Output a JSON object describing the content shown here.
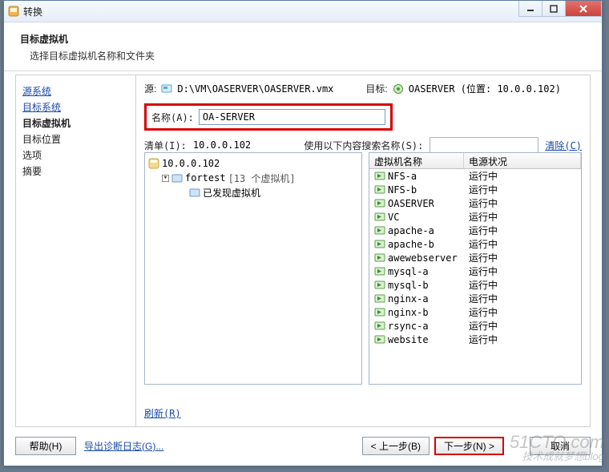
{
  "window": {
    "title": "转换"
  },
  "header": {
    "title": "目标虚拟机",
    "subtitle": "选择目标虚拟机名称和文件夹"
  },
  "sidebar": {
    "items": [
      {
        "label": "源系统",
        "type": "link"
      },
      {
        "label": "目标系统",
        "type": "link"
      },
      {
        "label": "目标虚拟机",
        "type": "current"
      },
      {
        "label": "目标位置",
        "type": "text"
      },
      {
        "label": "选项",
        "type": "text"
      },
      {
        "label": "摘要",
        "type": "text"
      }
    ]
  },
  "content": {
    "source_label": "源:",
    "source_path": "D:\\VM\\OASERVER\\OASERVER.vmx",
    "target_label": "目标:",
    "target_value": "OASERVER (位置: 10.0.0.102)",
    "name_label": "名称(A):",
    "name_value": "OA-SERVER",
    "list_label": "清单(I):",
    "list_value": "10.0.0.102",
    "search_label": "使用以下内容搜索名称(S):",
    "clear_label": "清除(C)",
    "refresh_label": "刷新(R)"
  },
  "tree": {
    "root": {
      "label": "10.0.0.102"
    },
    "folder": {
      "label": "fortest",
      "suffix": "[13 个虚拟机]"
    },
    "found": {
      "label": "已发现虚拟机"
    }
  },
  "listview": {
    "columns": {
      "name": "虚拟机名称",
      "power": "电源状况"
    },
    "rows": [
      {
        "name": "NFS-a",
        "power": "运行中"
      },
      {
        "name": "NFS-b",
        "power": "运行中"
      },
      {
        "name": "OASERVER",
        "power": "运行中"
      },
      {
        "name": "VC",
        "power": "运行中"
      },
      {
        "name": "apache-a",
        "power": "运行中"
      },
      {
        "name": "apache-b",
        "power": "运行中"
      },
      {
        "name": "awewebserver",
        "power": "运行中"
      },
      {
        "name": "mysql-a",
        "power": "运行中"
      },
      {
        "name": "mysql-b",
        "power": "运行中"
      },
      {
        "name": "nginx-a",
        "power": "运行中"
      },
      {
        "name": "nginx-b",
        "power": "运行中"
      },
      {
        "name": "rsync-a",
        "power": "运行中"
      },
      {
        "name": "website",
        "power": "运行中"
      }
    ]
  },
  "footer": {
    "help": "帮助(H)",
    "export_log": "导出诊断日志(G)...",
    "back": "< 上一步(B)",
    "next": "下一步(N) >",
    "cancel": "取消"
  },
  "watermark": {
    "line1": "51CTO.com",
    "line2": "技术成就梦想blog"
  }
}
